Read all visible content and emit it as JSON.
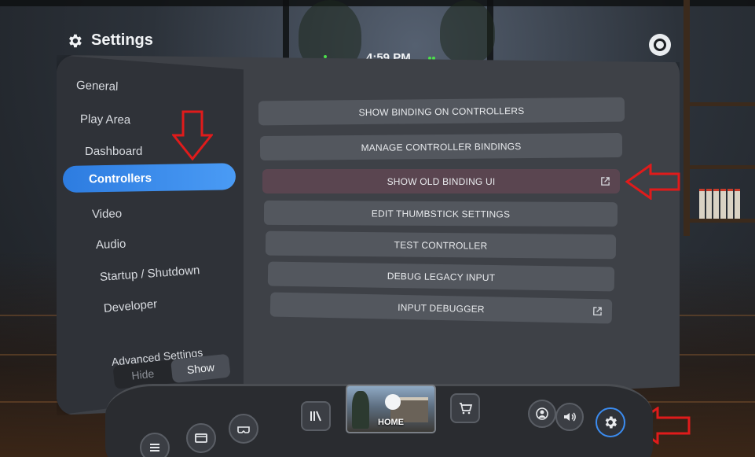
{
  "header": {
    "title": "Settings",
    "clock": "4:59 PM"
  },
  "sidebar": {
    "items": [
      {
        "label": "General"
      },
      {
        "label": "Play Area"
      },
      {
        "label": "Dashboard"
      },
      {
        "label": "Controllers",
        "active": true
      },
      {
        "label": "Video"
      },
      {
        "label": "Audio"
      },
      {
        "label": "Startup / Shutdown"
      },
      {
        "label": "Developer"
      }
    ],
    "advanced": {
      "label": "Advanced Settings",
      "options": [
        "Hide",
        "Show"
      ],
      "selected": "Show"
    }
  },
  "content": {
    "buttons": [
      {
        "label": "SHOW BINDING ON CONTROLLERS",
        "external": false
      },
      {
        "label": "MANAGE CONTROLLER BINDINGS",
        "external": false
      },
      {
        "label": "SHOW OLD BINDING UI",
        "external": true,
        "highlighted": true
      },
      {
        "label": "EDIT THUMBSTICK SETTINGS",
        "external": false
      },
      {
        "label": "TEST CONTROLLER",
        "external": false
      },
      {
        "label": "DEBUG LEGACY INPUT",
        "external": false
      },
      {
        "label": "INPUT DEBUGGER",
        "external": true
      }
    ]
  },
  "dock": {
    "home_label": "HOME",
    "icons": [
      "menu-icon",
      "desktop-icon",
      "vr-headset-icon",
      "library-icon",
      "store-icon",
      "avatar-icon",
      "volume-icon",
      "gear-icon"
    ]
  },
  "colors": {
    "accent": "#3b8cf0",
    "annotation_arrow": "#e01b1b"
  }
}
